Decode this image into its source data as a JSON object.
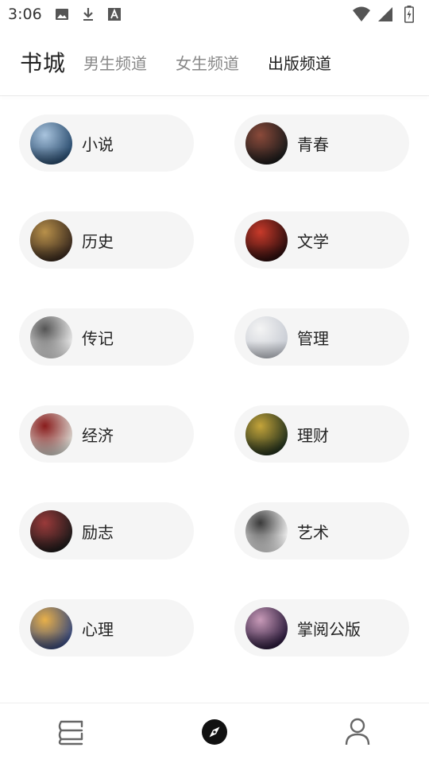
{
  "status_bar": {
    "time": "3:06",
    "left_icons": [
      "image-icon",
      "download-icon",
      "font-icon"
    ],
    "right_icons": [
      "wifi-icon",
      "signal-icon",
      "battery-icon"
    ]
  },
  "header": {
    "title": "书城",
    "tabs": [
      {
        "label": "男生频道",
        "active": false
      },
      {
        "label": "女生频道",
        "active": false
      },
      {
        "label": "出版频道",
        "active": true
      }
    ]
  },
  "categories": [
    {
      "label": "小说",
      "thumb_colors": [
        "#2a4c6e",
        "#a9c4de"
      ]
    },
    {
      "label": "青春",
      "thumb_colors": [
        "#1a1a1a",
        "#8b4a3a"
      ]
    },
    {
      "label": "历史",
      "thumb_colors": [
        "#3a2a1e",
        "#b8904a"
      ]
    },
    {
      "label": "文学",
      "thumb_colors": [
        "#2a0d0d",
        "#c83a2a"
      ]
    },
    {
      "label": "传记",
      "thumb_colors": [
        "#e8e8e8",
        "#555555"
      ]
    },
    {
      "label": "管理",
      "thumb_colors": [
        "#c8ccd4",
        "#f4f4f4"
      ]
    },
    {
      "label": "经济",
      "thumb_colors": [
        "#d7d3cc",
        "#8a1d1d"
      ]
    },
    {
      "label": "理财",
      "thumb_colors": [
        "#22301c",
        "#c4a43a"
      ]
    },
    {
      "label": "励志",
      "thumb_colors": [
        "#1e1a1a",
        "#9a3a3a"
      ]
    },
    {
      "label": "艺术",
      "thumb_colors": [
        "#f0f0f0",
        "#3a3a3a"
      ]
    },
    {
      "label": "心理",
      "thumb_colors": [
        "#3a4a7a",
        "#e8b04a"
      ]
    },
    {
      "label": "掌阅公版",
      "thumb_colors": [
        "#2a1a3a",
        "#c89ab8"
      ]
    }
  ],
  "bottom_nav": [
    {
      "icon": "bookshelf-icon",
      "active": false
    },
    {
      "icon": "compass-icon",
      "active": true
    },
    {
      "icon": "profile-icon",
      "active": false
    }
  ]
}
